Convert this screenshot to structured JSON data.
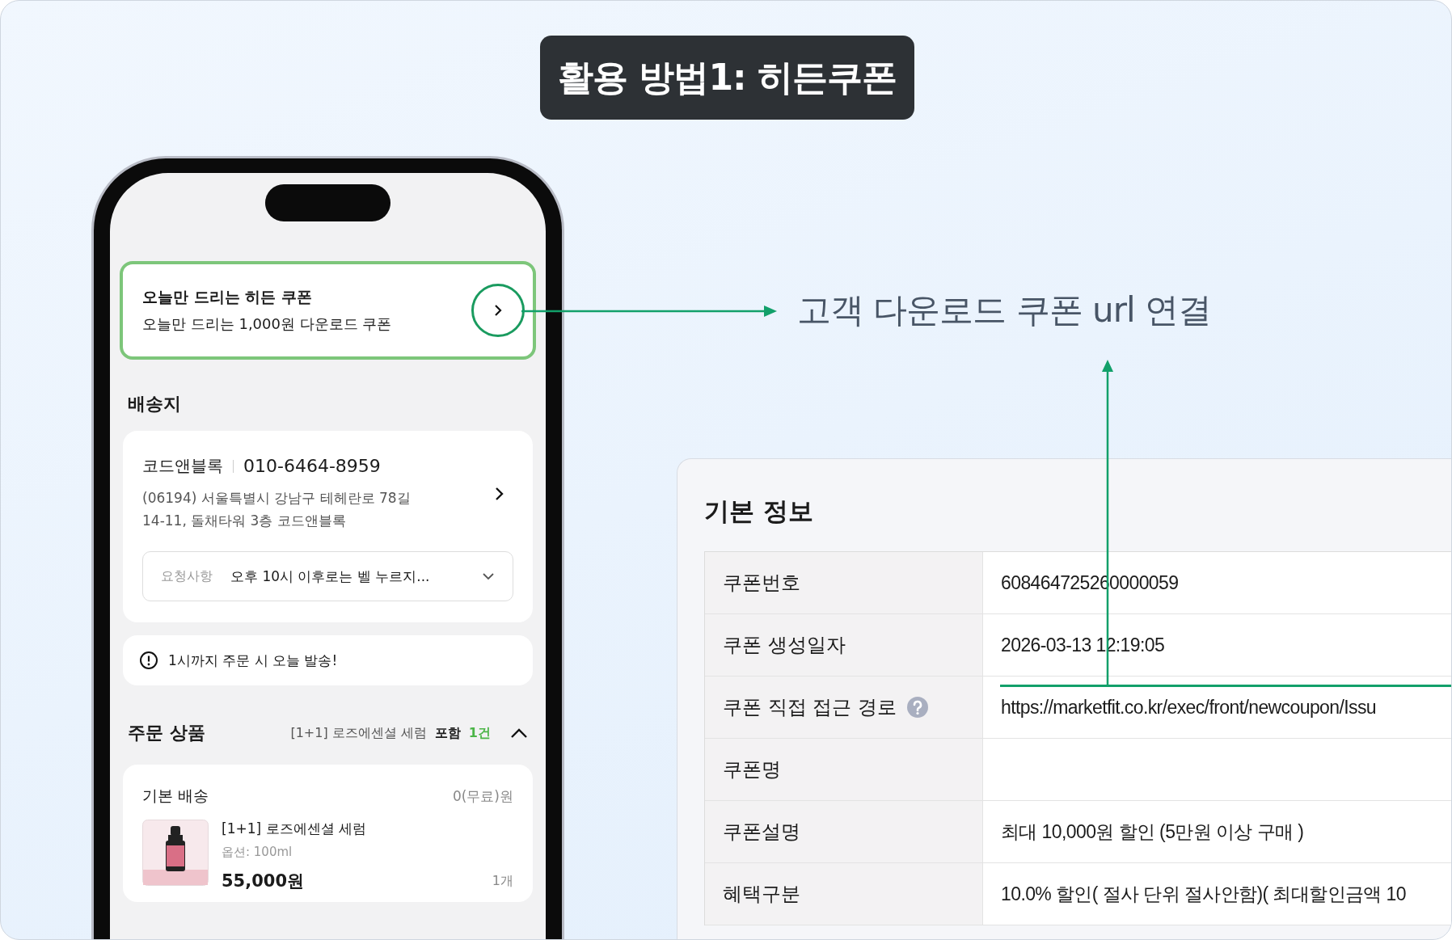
{
  "title": "활용 방법1: 히든쿠폰",
  "annotation": "고객 다운로드 쿠폰 url 연결",
  "phone": {
    "coupon_banner": {
      "title": "오늘만 드리는 히든 쿠폰",
      "subtitle": "오늘만 드리는 1,000원 다운로드 쿠폰"
    },
    "shipping": {
      "heading": "배송지",
      "name": "코드앤블록",
      "phone": "010-6464-8959",
      "address_lines": [
        "(06194) 서울특별시 강남구 테헤란로 78길",
        "14-11, 돌채타워 3층 코드앤블록"
      ],
      "request": {
        "label": "요청사항",
        "value": "오후 10시 이후로는 벨 누르지..."
      }
    },
    "notice": "1시까지 주문 시 오늘 발송!",
    "order": {
      "heading": "주문 상품",
      "summary": "[1+1] 로즈에센셜 세럼",
      "included_label": "포함",
      "count": "1건",
      "expanded": true,
      "delivery": {
        "label": "기본 배송",
        "fee": "0(무료)원"
      },
      "items": [
        {
          "name": "[1+1] 로즈에센셜 세럼",
          "option": "옵션: 100ml",
          "price": "55,000원",
          "quantity": "1개"
        }
      ]
    }
  },
  "panel": {
    "heading": "기본 정보",
    "rows": [
      {
        "label": "쿠폰번호",
        "value": "608464725260000059",
        "help": false
      },
      {
        "label": "쿠폰 생성일자",
        "value": "2026-03-13 12:19:05",
        "help": false
      },
      {
        "label": "쿠폰 직접 접근 경로",
        "value": "https://marketfit.co.kr/exec/front/newcoupon/Issu",
        "help": true
      },
      {
        "label": "쿠폰명",
        "help": false
      },
      {
        "label": "쿠폰설명",
        "value": "최대 10,000원 할인 (5만원 이상 구매 )",
        "help": false
      },
      {
        "label": "혜택구분",
        "value": "10.0% 할인( 절사 단위 절사안함)( 최대할인금액 10",
        "help": false
      }
    ]
  }
}
